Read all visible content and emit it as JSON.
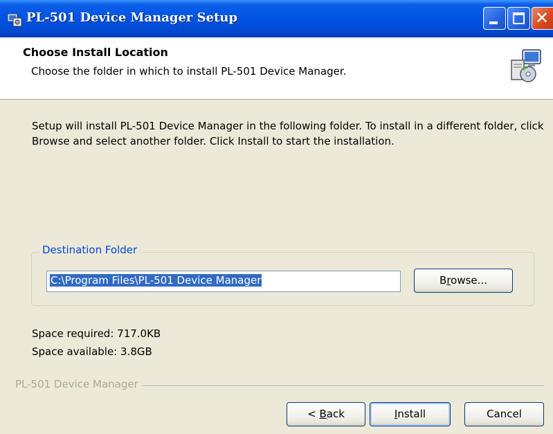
{
  "window": {
    "title": "PL-501 Device Manager Setup",
    "title_bar_color": "#0054e3",
    "close_button_color": "#d8491d"
  },
  "header": {
    "title": "Choose Install Location",
    "subtitle": "Choose the folder in which to install PL-501 Device Manager."
  },
  "body": {
    "description": "Setup will install PL-501 Device Manager in the following folder. To install in a different folder, click Browse and select another folder. Click Install to start the installation.",
    "destination_folder_label": "Destination Folder",
    "destination_path": "C:\\Program Files\\PL-501 Device Manager",
    "browse_prefix": "B",
    "browse_accel": "r",
    "browse_suffix": "owse...",
    "space_required": "Space required: 717.0KB",
    "space_available": "Space available: 3.8GB"
  },
  "footer": {
    "brand": "PL-501 Device Manager",
    "back_prefix": "< ",
    "back_accel": "B",
    "back_suffix": "ack",
    "install_accel": "I",
    "install_suffix": "nstall",
    "cancel_label": "Cancel"
  },
  "icons": {
    "app": "installer-icon",
    "header": "computer-cd-icon",
    "minimize": "minimize-icon",
    "maximize": "maximize-icon",
    "close": "close-icon"
  }
}
